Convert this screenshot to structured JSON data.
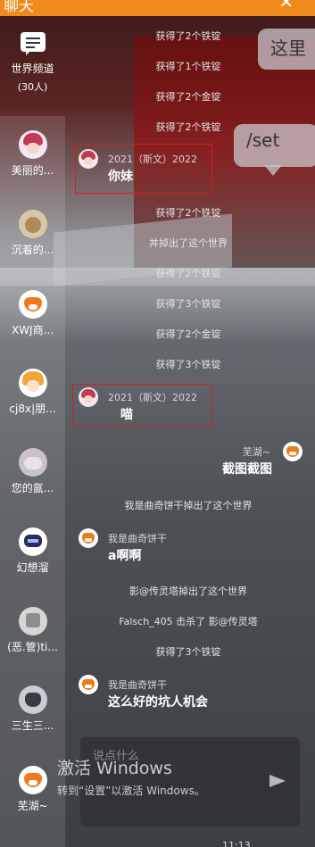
{
  "header": {
    "title": "聊天",
    "close": "✕"
  },
  "sidebar": {
    "world": {
      "name": "世界频道",
      "count": "(30人)"
    },
    "channels": [
      {
        "name": "美丽的...",
        "avatar": "pink-hair-avatar"
      },
      {
        "name": "沉着的...",
        "avatar": "dog-avatar"
      },
      {
        "name": "XWJ商...",
        "avatar": "fox-avatar"
      },
      {
        "name": "cj8x|朋...",
        "avatar": "blonde-avatar"
      },
      {
        "name": "您的氤...",
        "avatar": "cloud-avatar"
      },
      {
        "name": "幻想溜",
        "avatar": "hat-avatar"
      },
      {
        "name": "(恶.管)ti...",
        "avatar": "skull-avatar"
      },
      {
        "name": "三生三...",
        "avatar": "cat-avatar"
      },
      {
        "name": "芜湖~",
        "avatar": "fox-avatar"
      }
    ]
  },
  "messages": {
    "sys1": "获得了2个铁锭",
    "sys2": "获得了1个铁锭",
    "sys3": "获得了2个金锭",
    "sys4": "获得了2个铁锭",
    "m1": {
      "user": "2021（斯文）2022",
      "text": "你妹"
    },
    "sys5": "获得了2个铁锭",
    "sys6": "丼掉出了这个世界",
    "sys7": "获得了2个铁锭",
    "sys8": "获得了3个铁锭",
    "sys9": "获得了2个金锭",
    "sys10": "获得了3个铁锭",
    "m2": {
      "user": "2021（斯文）2022",
      "text": "喵"
    },
    "m3": {
      "user": "芜湖~",
      "text": "截图截图"
    },
    "sys11": "我是曲奇饼干掉出了这个世界",
    "m4": {
      "user": "我是曲奇饼干",
      "text": "a啊啊"
    },
    "sys12": "影@传灵塔掉出了这个世界",
    "sys13": "Falsch_405 击杀了 影@传灵塔",
    "sys14": "获得了3个铁锭",
    "m5": {
      "user": "我是曲奇饼干",
      "text": "这么好的坑人机会"
    }
  },
  "game": {
    "bubble1": "这里",
    "bubble2": "/set"
  },
  "input": {
    "placeholder": "说点什么"
  },
  "watermark": {
    "line1": "激活 Windows",
    "line2": "转到“设置”以激活 Windows。"
  },
  "clock": "11:13",
  "colors": {
    "accent": "#f08a1c",
    "highlight": "#d81e1e"
  }
}
